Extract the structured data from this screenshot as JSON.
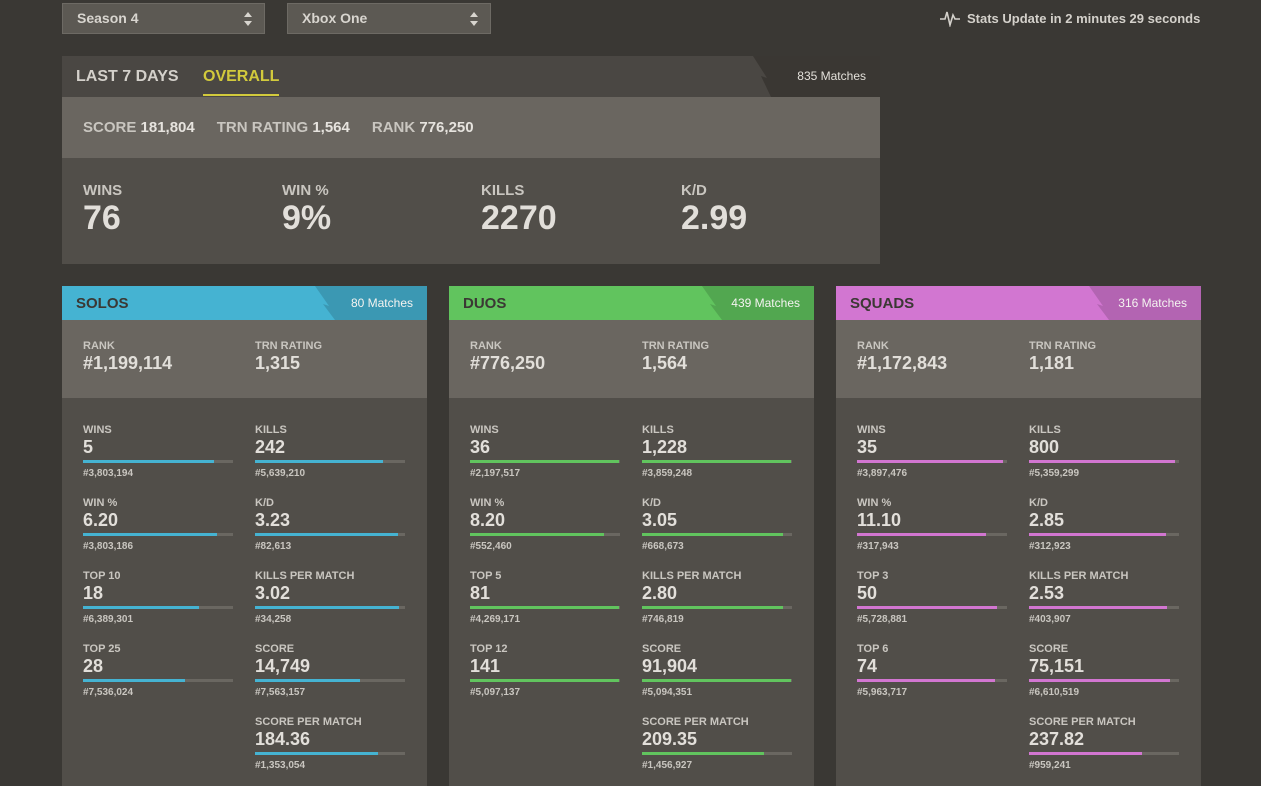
{
  "selectors": {
    "season": "Season 4",
    "platform": "Xbox One"
  },
  "stats_update": "Stats Update in 2 minutes 29 seconds",
  "overview": {
    "tabs": [
      "LAST 7 DAYS",
      "OVERALL"
    ],
    "matches": "835 Matches",
    "score_label": "SCORE",
    "score_value": "181,804",
    "trn_label": "TRN RATING",
    "trn_value": "1,564",
    "rank_label": "RANK",
    "rank_value": "776,250",
    "stats": [
      {
        "label": "WINS",
        "value": "76"
      },
      {
        "label": "WIN %",
        "value": "9%"
      },
      {
        "label": "KILLS",
        "value": "2270"
      },
      {
        "label": "K/D",
        "value": "2.99"
      }
    ]
  },
  "colors": {
    "solos": "#45b3d2",
    "duos": "#61c45e",
    "squads": "#d276d1",
    "accent": "#d2ca3c"
  },
  "cards": [
    {
      "title": "SOLOS",
      "matches": "80 Matches",
      "color": "#45b3d2",
      "rank_label": "RANK",
      "rank": "#1,199,114",
      "trn_label": "TRN RATING",
      "trn": "1,315",
      "left": [
        {
          "label": "WINS",
          "value": "5",
          "rank": "#3,803,194",
          "fill": 0.87
        },
        {
          "label": "WIN %",
          "value": "6.20",
          "rank": "#3,803,186",
          "fill": 0.89
        },
        {
          "label": "TOP 10",
          "value": "18",
          "rank": "#6,389,301",
          "fill": 0.77
        },
        {
          "label": "TOP 25",
          "value": "28",
          "rank": "#7,536,024",
          "fill": 0.68
        }
      ],
      "right": [
        {
          "label": "KILLS",
          "value": "242",
          "rank": "#5,639,210",
          "fill": 0.85
        },
        {
          "label": "K/D",
          "value": "3.23",
          "rank": "#82,613",
          "fill": 0.95
        },
        {
          "label": "KILLS PER MATCH",
          "value": "3.02",
          "rank": "#34,258",
          "fill": 0.96
        },
        {
          "label": "SCORE",
          "value": "14,749",
          "rank": "#7,563,157",
          "fill": 0.7
        },
        {
          "label": "SCORE PER MATCH",
          "value": "184.36",
          "rank": "#1,353,054",
          "fill": 0.82
        }
      ]
    },
    {
      "title": "DUOS",
      "matches": "439 Matches",
      "color": "#61c45e",
      "rank_label": "RANK",
      "rank": "#776,250",
      "trn_label": "TRN RATING",
      "trn": "1,564",
      "left": [
        {
          "label": "WINS",
          "value": "36",
          "rank": "#2,197,517",
          "fill": 0.99
        },
        {
          "label": "WIN %",
          "value": "8.20",
          "rank": "#552,460",
          "fill": 0.89
        },
        {
          "label": "TOP 5",
          "value": "81",
          "rank": "#4,269,171",
          "fill": 0.99
        },
        {
          "label": "TOP 12",
          "value": "141",
          "rank": "#5,097,137",
          "fill": 0.99
        }
      ],
      "right": [
        {
          "label": "KILLS",
          "value": "1,228",
          "rank": "#3,859,248",
          "fill": 0.99
        },
        {
          "label": "K/D",
          "value": "3.05",
          "rank": "#668,673",
          "fill": 0.94
        },
        {
          "label": "KILLS PER MATCH",
          "value": "2.80",
          "rank": "#746,819",
          "fill": 0.94
        },
        {
          "label": "SCORE",
          "value": "91,904",
          "rank": "#5,094,351",
          "fill": 0.99
        },
        {
          "label": "SCORE PER MATCH",
          "value": "209.35",
          "rank": "#1,456,927",
          "fill": 0.81
        }
      ]
    },
    {
      "title": "SQUADS",
      "matches": "316 Matches",
      "color": "#d276d1",
      "rank_label": "RANK",
      "rank": "#1,172,843",
      "trn_label": "TRN RATING",
      "trn": "1,181",
      "left": [
        {
          "label": "WINS",
          "value": "35",
          "rank": "#3,897,476",
          "fill": 0.97
        },
        {
          "label": "WIN %",
          "value": "11.10",
          "rank": "#317,943",
          "fill": 0.86
        },
        {
          "label": "TOP 3",
          "value": "50",
          "rank": "#5,728,881",
          "fill": 0.93
        },
        {
          "label": "TOP 6",
          "value": "74",
          "rank": "#5,963,717",
          "fill": 0.92
        }
      ],
      "right": [
        {
          "label": "KILLS",
          "value": "800",
          "rank": "#5,359,299",
          "fill": 0.97
        },
        {
          "label": "K/D",
          "value": "2.85",
          "rank": "#312,923",
          "fill": 0.91
        },
        {
          "label": "KILLS PER MATCH",
          "value": "2.53",
          "rank": "#403,907",
          "fill": 0.92
        },
        {
          "label": "SCORE",
          "value": "75,151",
          "rank": "#6,610,519",
          "fill": 0.94
        },
        {
          "label": "SCORE PER MATCH",
          "value": "237.82",
          "rank": "#959,241",
          "fill": 0.75
        }
      ]
    }
  ]
}
